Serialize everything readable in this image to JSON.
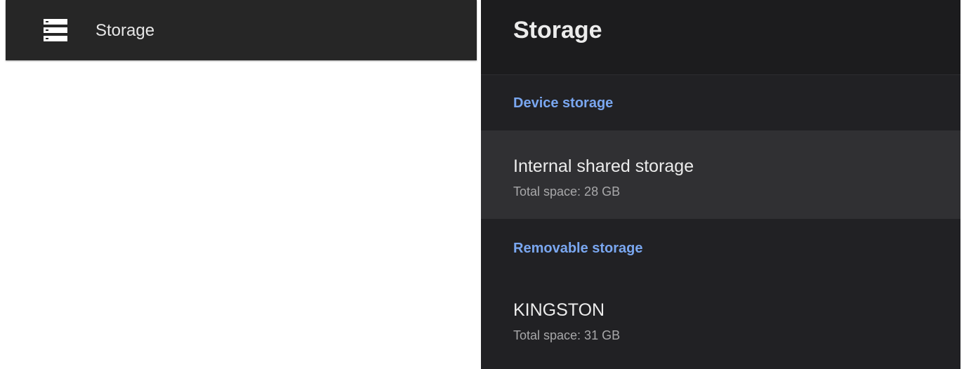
{
  "menu": {
    "icon": "storage-icon",
    "label": "Storage"
  },
  "panel": {
    "title": "Storage",
    "sections": [
      {
        "header": "Device storage",
        "items": [
          {
            "title": "Internal shared storage",
            "subtitle": "Total space: 28 GB",
            "focused": true
          }
        ]
      },
      {
        "header": "Removable storage",
        "items": [
          {
            "title": "KINGSTON",
            "subtitle": "Total space: 31 GB",
            "focused": false
          }
        ]
      }
    ]
  },
  "colors": {
    "accent": "#7aa7f0",
    "panel_background": "#212124",
    "focused_row": "#303033"
  }
}
